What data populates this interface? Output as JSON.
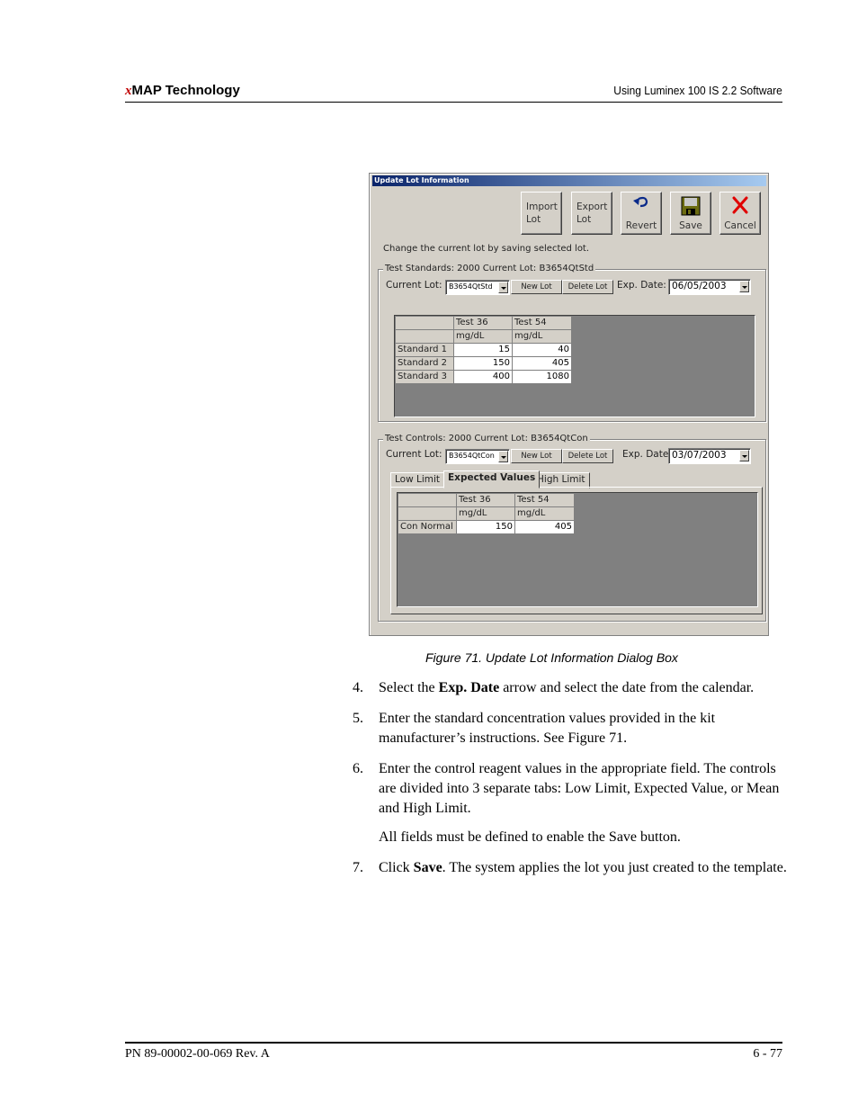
{
  "header": {
    "brand_prefix": "x",
    "brand_rest": "MAP Technology",
    "doc_title": "Using Luminex 100 IS 2.2 Software"
  },
  "dialog": {
    "title": "Update Lot Information",
    "toolbar": {
      "import_label": "Import\nLot",
      "export_label": "Export\nLot",
      "revert_label": "Revert",
      "save_label": "Save",
      "cancel_label": "Cancel",
      "icons": {
        "revert": "undo-arrow-icon",
        "save": "floppy-disk-icon",
        "cancel": "red-x-icon"
      }
    },
    "instruction": "Change the current lot by saving selected lot.",
    "standards": {
      "legend": "Test Standards: 2000 Current Lot: B3654QtStd",
      "current_lot_label": "Current Lot:",
      "current_lot_value": "B3654QtStd",
      "new_lot_label": "New Lot",
      "delete_lot_label": "Delete Lot",
      "exp_date_label": "Exp. Date:",
      "exp_date_value": "06/05/2003",
      "columns": [
        "Test 36",
        "Test 54"
      ],
      "units": [
        "mg/dL",
        "mg/dL"
      ],
      "rows": [
        {
          "label": "Standard 1",
          "values": [
            "15",
            "40"
          ]
        },
        {
          "label": "Standard 2",
          "values": [
            "150",
            "405"
          ]
        },
        {
          "label": "Standard 3",
          "values": [
            "400",
            "1080"
          ]
        }
      ]
    },
    "controls": {
      "legend": "Test Controls: 2000 Current Lot: B3654QtCon",
      "current_lot_label": "Current Lot:",
      "current_lot_value": "B3654QtCon",
      "new_lot_label": "New Lot",
      "delete_lot_label": "Delete Lot",
      "exp_date_label": "Exp. Date",
      "exp_date_value": "03/07/2003",
      "tabs": [
        "Low Limit",
        "Expected Values",
        "High Limit"
      ],
      "active_tab": "Expected Values",
      "columns": [
        "Test 36",
        "Test 54"
      ],
      "units": [
        "mg/dL",
        "mg/dL"
      ],
      "rows": [
        {
          "label": "Con Normal",
          "values": [
            "150",
            "405"
          ]
        }
      ]
    }
  },
  "figure_caption": "Figure 71.  Update Lot Information Dialog Box",
  "steps": [
    {
      "num": "4.",
      "pre": "Select the ",
      "bold": "Exp. Date",
      "post": " arrow and select the date from the calendar."
    },
    {
      "num": "5.",
      "text": "Enter the standard concentration values provided in the kit manufacturer’s instructions. See Figure 71."
    },
    {
      "num": "6.",
      "text": "Enter the control reagent values in the appropriate field. The controls are divided into 3 separate tabs: Low Limit, Expected Value, or Mean and High Limit."
    },
    {
      "note": "All fields must be defined to enable the Save button."
    },
    {
      "num": "7.",
      "pre": "Click ",
      "bold": "Save",
      "post": ". The system applies the lot you just created to the template."
    }
  ],
  "footer": {
    "part_number": "PN 89-00002-00-069 Rev. A",
    "page": "6 - 77"
  }
}
